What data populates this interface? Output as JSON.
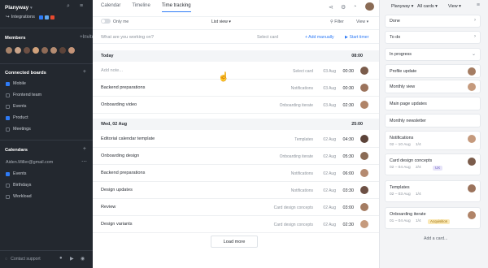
{
  "sidebar": {
    "workspace": "Planyway",
    "integrations": "Integrations",
    "members_label": "Members",
    "invite": "+Invite",
    "connected_label": "Connected boards",
    "boards": [
      {
        "label": "Mobile",
        "checked": true
      },
      {
        "label": "Frontend team",
        "checked": false
      },
      {
        "label": "Events",
        "checked": false
      },
      {
        "label": "Product",
        "checked": true
      },
      {
        "label": "Meetings",
        "checked": false
      }
    ],
    "calendars_label": "Calendars",
    "email": "Aiden.Miller@gmail.com",
    "calendars": [
      {
        "label": "Events",
        "checked": true
      },
      {
        "label": "Birthdays",
        "checked": false
      },
      {
        "label": "Workload",
        "checked": false
      }
    ],
    "contact": "Contact support"
  },
  "tabs": [
    "Calendar",
    "Timeline",
    "Time tracking"
  ],
  "toolbar": {
    "only_me": "Only me",
    "list_view": "List view",
    "filter": "Filter",
    "view": "View"
  },
  "entry": {
    "placeholder": "What are you working on?",
    "select_card": "Select card",
    "add_manually": "+ Add manually",
    "start_timer": "Start timer"
  },
  "groups": [
    {
      "label": "Today",
      "total": "08:00"
    },
    {
      "label": "Wed, 02 Aug",
      "total": "25:00"
    }
  ],
  "rows_today": [
    {
      "name": "Add note...",
      "project": "Select card",
      "date": "03 Aug",
      "time": "00:30",
      "muted": true
    },
    {
      "name": "Backend preparations",
      "project": "Notifications",
      "date": "03 Aug",
      "time": "00:30"
    },
    {
      "name": "Onboarding video",
      "project": "Onboarding iterate",
      "date": "03 Aug",
      "time": "02:30"
    }
  ],
  "rows_wed": [
    {
      "name": "Editorial calendar template",
      "project": "Templates",
      "date": "02 Aug",
      "time": "04:30"
    },
    {
      "name": "Onboarding design",
      "project": "Onboarding iterate",
      "date": "02 Aug",
      "time": "05:30"
    },
    {
      "name": "Backend preparations",
      "project": "Notifications",
      "date": "02 Aug",
      "time": "06:00"
    },
    {
      "name": "Design updates",
      "project": "Notifications",
      "date": "02 Aug",
      "time": "03:30"
    },
    {
      "name": "Review",
      "project": "Card design concepts",
      "date": "02 Aug",
      "time": "03:00"
    },
    {
      "name": "Design variants",
      "project": "Card design concepts",
      "date": "02 Aug",
      "time": "02:30"
    }
  ],
  "load_more": "Load more",
  "right": {
    "workspace": "Planyway",
    "all_cards": "All cards",
    "view": "View",
    "columns": [
      "Done",
      "To do",
      "In progress"
    ],
    "cards": [
      {
        "title": "Profile update"
      },
      {
        "title": "Monthly view"
      },
      {
        "title": "Main page updates"
      },
      {
        "title": "Monthly newsletter"
      },
      {
        "title": "Notifications",
        "meta": "02 – 10 Aug",
        "meta2": "1/4"
      },
      {
        "title": "Card design concepts",
        "meta": "02 – 04 Aug",
        "meta2": "2/4",
        "tag": "UX"
      },
      {
        "title": "Templates",
        "meta": "02 – 03 Aug",
        "meta2": "1/4"
      },
      {
        "title": "Onboarding iterate",
        "meta": "01 – 04 Aug",
        "meta2": "1/4",
        "tag": "Acquisition"
      }
    ],
    "add_card": "Add a card..."
  },
  "colors": {
    "accent": "#2e7bf6",
    "sidebar": "#23282f"
  }
}
